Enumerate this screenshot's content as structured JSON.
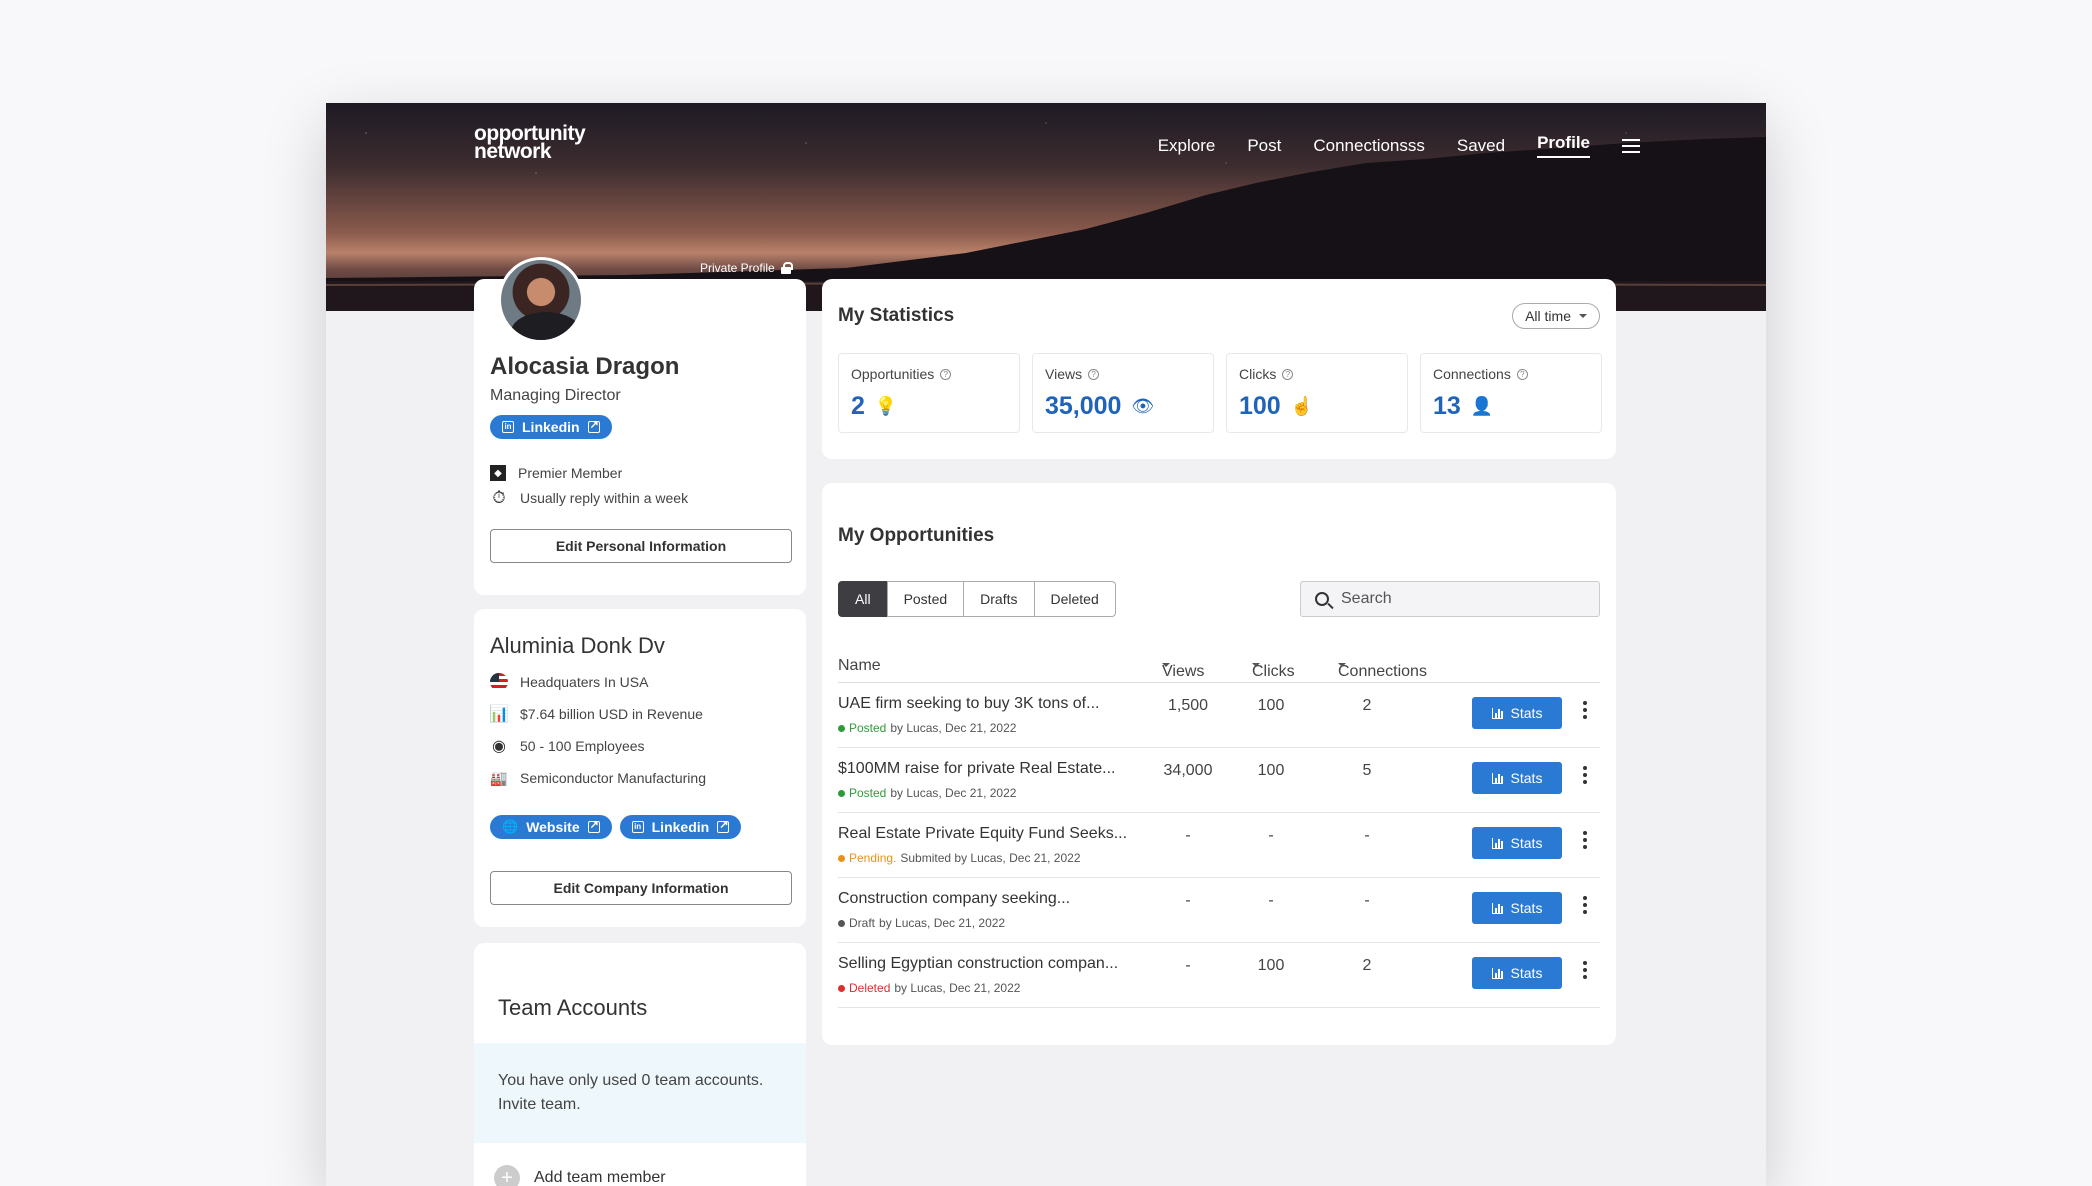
{
  "header": {
    "logo_line1": "opportunity",
    "logo_line2": "network",
    "nav": [
      "Explore",
      "Post",
      "Connectionsss",
      "Saved",
      "Profile"
    ],
    "private_label": "Private Profile"
  },
  "profile": {
    "name": "Alocasia Dragon",
    "role": "Managing Director",
    "linkedin_label": "Linkedin",
    "membership": "Premier Member",
    "reply_note": "Usually reply within a week",
    "edit_button": "Edit Personal Information"
  },
  "company": {
    "name": "Aluminia Donk Dv",
    "headquarters": "Headquaters In USA",
    "revenue": "$7.64 billion USD in Revenue",
    "employees": "50 - 100 Employees",
    "industry": "Semiconductor Manufacturing",
    "website_label": "Website",
    "linkedin_label": "Linkedin",
    "edit_button": "Edit Company Information"
  },
  "team": {
    "title": "Team Accounts",
    "note": "You have only used 0 team accounts. Invite team.",
    "add_label": "Add team member"
  },
  "statistics": {
    "title": "My Statistics",
    "range": "All time",
    "items": [
      {
        "label": "Opportunities",
        "value": "2",
        "icon": "lightbulb-icon"
      },
      {
        "label": "Views",
        "value": "35,000",
        "icon": "eye-icon"
      },
      {
        "label": "Clicks",
        "value": "100",
        "icon": "click-icon"
      },
      {
        "label": "Connections",
        "value": "13",
        "icon": "person-icon"
      }
    ]
  },
  "opportunities": {
    "title": "My Opportunities",
    "tabs": [
      "All",
      "Posted",
      "Drafts",
      "Deleted"
    ],
    "search_placeholder": "Search",
    "columns": [
      "Name",
      "Views",
      "Clicks",
      "Connections"
    ],
    "stats_label": "Stats",
    "rows": [
      {
        "title": "UAE firm seeking to buy 3K tons of...",
        "status": "Posted",
        "status_color": "#2e9b3a",
        "meta": "by Lucas, Dec 21, 2022",
        "views": "1,500",
        "clicks": "100",
        "connections": "2"
      },
      {
        "title": "$100MM raise for private Real Estate...",
        "status": "Posted",
        "status_color": "#2e9b3a",
        "meta": "by Lucas, Dec 21, 2022",
        "views": "34,000",
        "clicks": "100",
        "connections": "5"
      },
      {
        "title": "Real Estate Private Equity Fund Seeks...",
        "status": "Pending.",
        "status_color": "#e8921c",
        "meta": "Submited by Lucas, Dec 21, 2022",
        "views": "-",
        "clicks": "-",
        "connections": "-"
      },
      {
        "title": "Construction company seeking...",
        "status": "Draft",
        "status_color": "#555555",
        "meta": "by Lucas, Dec 21, 2022",
        "views": "-",
        "clicks": "-",
        "connections": "-"
      },
      {
        "title": "Selling Egyptian construction compan...",
        "status": "Deleted",
        "status_color": "#d93030",
        "meta": "by Lucas, Dec 21, 2022",
        "views": "-",
        "clicks": "100",
        "connections": "2"
      }
    ]
  }
}
